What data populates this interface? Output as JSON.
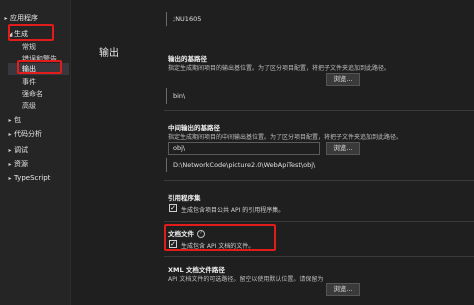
{
  "sidebar": {
    "items": [
      {
        "label": "应用程序",
        "caret": "▸"
      },
      {
        "label": "生成",
        "caret": "◢"
      },
      {
        "label": "常规"
      },
      {
        "label": "错误和警告"
      },
      {
        "label": "输出"
      },
      {
        "label": "事件"
      },
      {
        "label": "强命名"
      },
      {
        "label": "高级"
      },
      {
        "label": "包",
        "caret": "▸"
      },
      {
        "label": "代码分析",
        "caret": "▸"
      },
      {
        "label": "调试",
        "caret": "▸"
      },
      {
        "label": "资源",
        "caret": "▸"
      },
      {
        "label": "TypeScript",
        "caret": "▸"
      }
    ]
  },
  "main": {
    "top_value": ";NU1605",
    "section_title": "输出",
    "base_output": {
      "label": "输出的基路径",
      "desc": "指定生成期间项目的输出基位置。为了区分项目配置，将把子文件夹追加到此路径。",
      "button": "浏览...",
      "value": "bin\\"
    },
    "intermediate_output": {
      "label": "中间输出的基路径",
      "desc": "指定生成期间项目的中间输出基位置。为了区分项目配置，将把子文件夹追加到此路径。",
      "value": "obj\\",
      "button": "浏览...",
      "resolved": "D:\\NetworkCode\\picture2.0\\WebApiTest\\obj\\"
    },
    "reference_assembly": {
      "label": "引用程序集",
      "checkbox_label": "生成包含项目公共 API 的引用程序集。",
      "checked": true
    },
    "doc_file": {
      "label": "文档文件",
      "checkbox_label": "生成包含 API 文档的文件。",
      "checked": true
    },
    "xml_doc_path": {
      "label": "XML 文档文件路径",
      "desc": "API 文档文件的可选路径。留空以使用默认位置。请保留为",
      "button": "浏览..."
    }
  },
  "colors": {
    "highlight": "#e21b1b",
    "background": "#1f1f1f",
    "sidebar": "#252526"
  }
}
